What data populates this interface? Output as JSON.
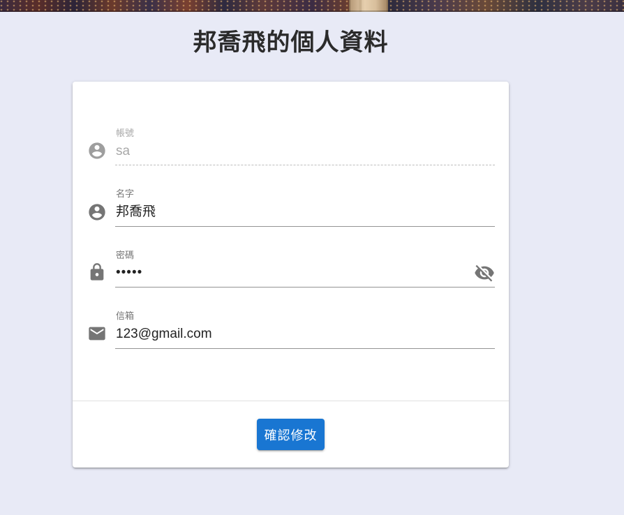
{
  "page": {
    "title": "邦喬飛的個人資料"
  },
  "form": {
    "account": {
      "label": "帳號",
      "value": "sa",
      "icon": "account-circle-icon",
      "disabled": true
    },
    "name": {
      "label": "名字",
      "value": "邦喬飛",
      "icon": "account-circle-icon"
    },
    "password": {
      "label": "密碼",
      "value": "•••••",
      "icon": "lock-icon",
      "toggle_icon": "eye-off-icon"
    },
    "email": {
      "label": "信箱",
      "value": "123@gmail.com",
      "icon": "email-icon"
    }
  },
  "actions": {
    "confirm_label": "確認修改"
  },
  "colors": {
    "background": "#e8eaf6",
    "card": "#ffffff",
    "primary": "#1976d2",
    "icon": "#757575",
    "icon_disabled": "#9e9e9e"
  }
}
